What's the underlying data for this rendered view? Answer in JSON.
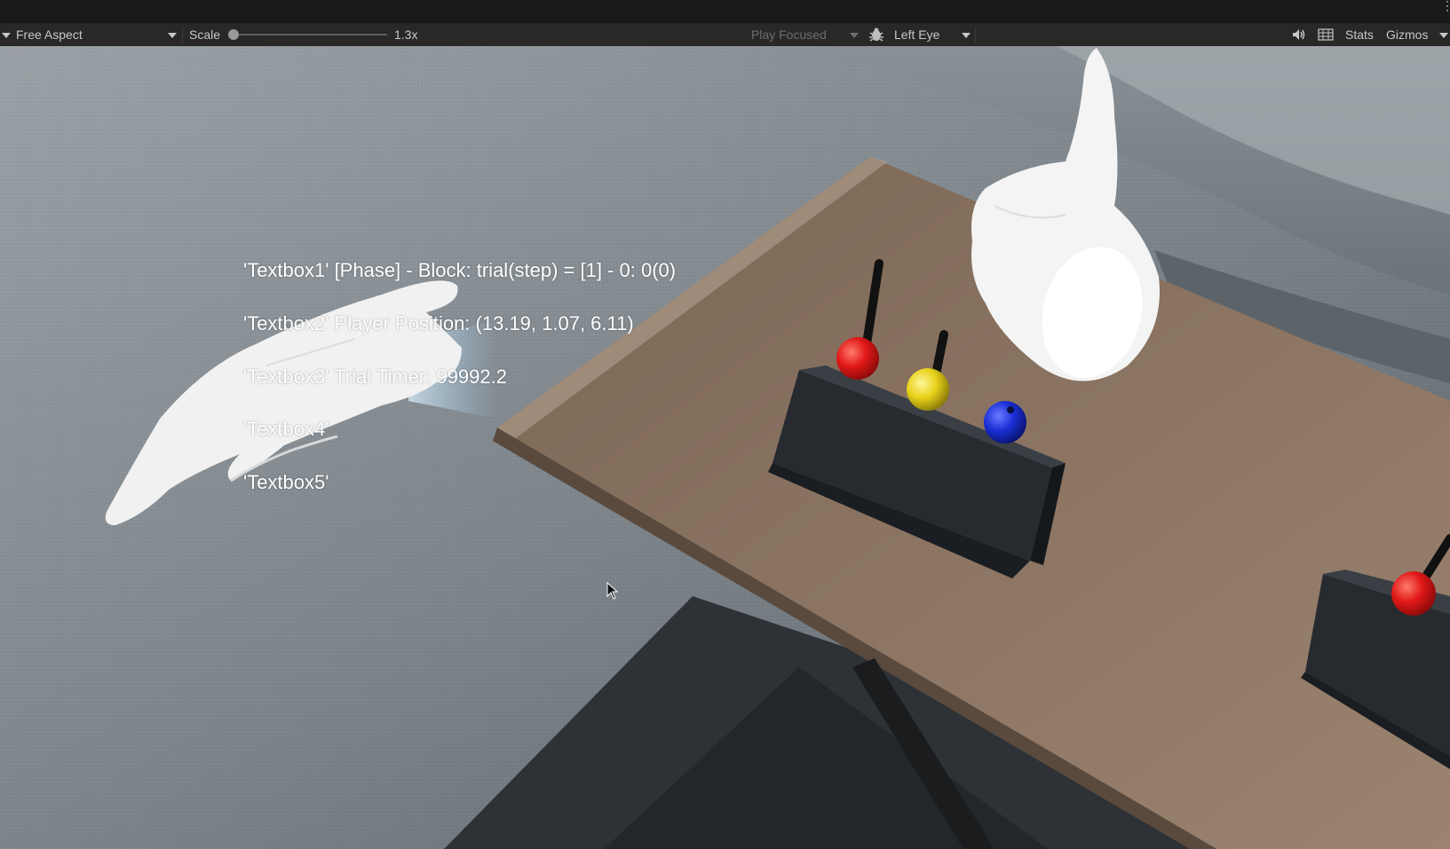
{
  "toolbar": {
    "aspect_label": "Free Aspect",
    "scale_label": "Scale",
    "scale_value": "1.3x",
    "scale_fraction": 0.0,
    "play_mode_label": "Play Focused",
    "eye_label": "Left Eye",
    "stats_label": "Stats",
    "gizmos_label": "Gizmos",
    "icons": [
      "dropdown-arrow-icon",
      "bug-icon",
      "speaker-icon",
      "grid-icon",
      "kebab-menu-icon"
    ]
  },
  "hud": {
    "lines": [
      "'Textbox1' [Phase] - Block: trial(step)  =  [1] - 0: 0(0)",
      "'Textbox2' Player Position: (13.19, 1.07, 6.11)",
      "'Textbox3' Trial Timer: 99992.2",
      "'Textbox4'",
      "'Textbox5'"
    ]
  },
  "scene": {
    "objects": [
      "wall",
      "couch",
      "table",
      "left-hand",
      "right-hand",
      "peg-board",
      "peg-board-secondary"
    ],
    "ball_colors": {
      "red": "#e01818",
      "yellow": "#e8d21a",
      "blue": "#1a2fd6"
    }
  }
}
